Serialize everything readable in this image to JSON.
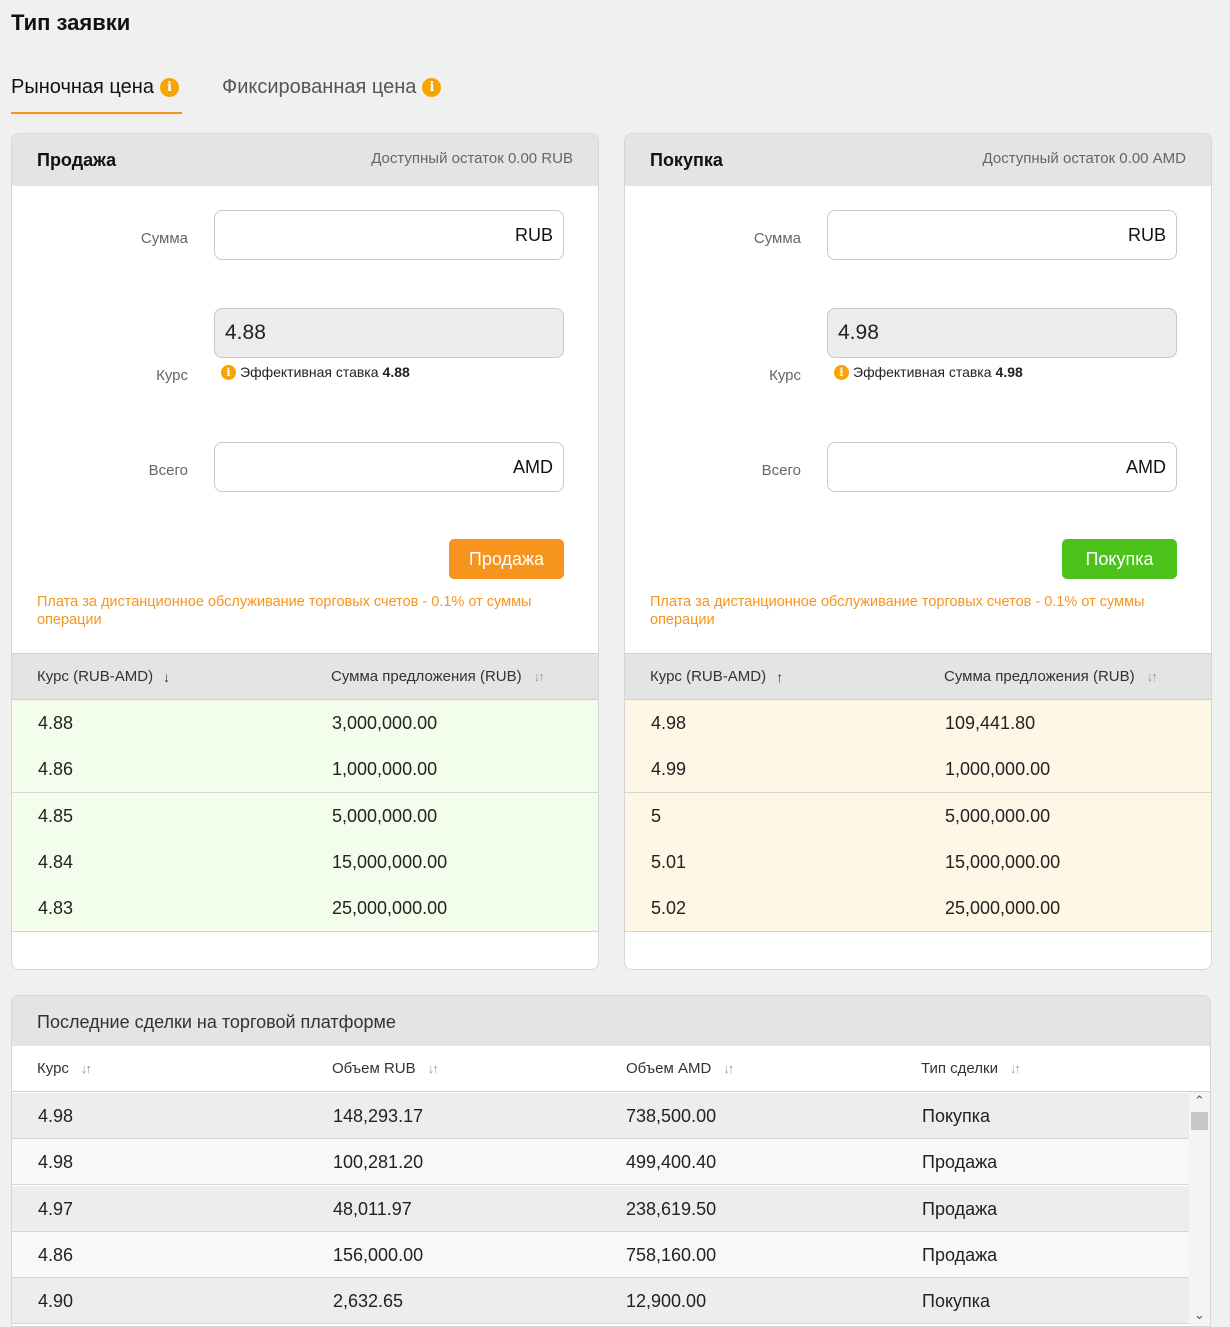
{
  "page": {
    "title": "Тип заявки"
  },
  "tabs": [
    {
      "label": "Рыночная цена",
      "active": true
    },
    {
      "label": "Фиксированная цена",
      "active": false
    }
  ],
  "sell_panel": {
    "title": "Продажа",
    "balance": "Доступный остаток 0.00 RUB",
    "amount_label": "Сумма",
    "amount_currency": "RUB",
    "amount_value": "",
    "rate_label": "Курс",
    "rate_value": "4.88",
    "effective_rate_label": "Эффективная ставка",
    "effective_rate_value": "4.88",
    "total_label": "Всего",
    "total_currency": "AMD",
    "total_value": "",
    "button_label": "Продажа",
    "fee_note": "Плата за дистанционное обслуживание торговых счетов - 0.1% от суммы операции",
    "orderbook_headers": {
      "rate": "Курс (RUB-AMD)",
      "amount": "Сумма предложения (RUB)"
    },
    "orderbook": [
      {
        "rate": "4.88",
        "amount": "3,000,000.00"
      },
      {
        "rate": "4.86",
        "amount": "1,000,000.00"
      },
      {
        "rate": "4.85",
        "amount": "5,000,000.00"
      },
      {
        "rate": "4.84",
        "amount": "15,000,000.00"
      },
      {
        "rate": "4.83",
        "amount": "25,000,000.00"
      }
    ]
  },
  "buy_panel": {
    "title": "Покупка",
    "balance": "Доступный остаток 0.00 AMD",
    "amount_label": "Сумма",
    "amount_currency": "RUB",
    "amount_value": "",
    "rate_label": "Курс",
    "rate_value": "4.98",
    "effective_rate_label": "Эффективная ставка",
    "effective_rate_value": "4.98",
    "total_label": "Всего",
    "total_currency": "AMD",
    "total_value": "",
    "button_label": "Покупка",
    "fee_note": "Плата за дистанционное обслуживание торговых счетов - 0.1% от суммы операции",
    "orderbook_headers": {
      "rate": "Курс (RUB-AMD)",
      "amount": "Сумма предложения (RUB)"
    },
    "orderbook": [
      {
        "rate": "4.98",
        "amount": "109,441.80"
      },
      {
        "rate": "4.99",
        "amount": "1,000,000.00"
      },
      {
        "rate": "5",
        "amount": "5,000,000.00"
      },
      {
        "rate": "5.01",
        "amount": "15,000,000.00"
      },
      {
        "rate": "5.02",
        "amount": "25,000,000.00"
      }
    ]
  },
  "trades": {
    "title": "Последние сделки на торговой платформе",
    "headers": {
      "rate": "Курс",
      "vol_rub": "Объем RUB",
      "vol_amd": "Объем AMD",
      "type": "Тип сделки"
    },
    "rows": [
      {
        "rate": "4.98",
        "vol_rub": "148,293.17",
        "vol_amd": "738,500.00",
        "type": "Покупка"
      },
      {
        "rate": "4.98",
        "vol_rub": "100,281.20",
        "vol_amd": "499,400.40",
        "type": "Продажа"
      },
      {
        "rate": "4.97",
        "vol_rub": "48,011.97",
        "vol_amd": "238,619.50",
        "type": "Продажа"
      },
      {
        "rate": "4.86",
        "vol_rub": "156,000.00",
        "vol_amd": "758,160.00",
        "type": "Продажа"
      },
      {
        "rate": "4.90",
        "vol_rub": "2,632.65",
        "vol_amd": "12,900.00",
        "type": "Покупка"
      }
    ]
  },
  "colors": {
    "accent_orange": "#f7941d",
    "buy_green": "#4cc21b",
    "sell_row_bg": "#f3fdec",
    "buy_row_bg": "#fff7e6",
    "info_icon": "#f7a400"
  },
  "icons": {
    "info": "i",
    "sort_desc": "↓",
    "sort_asc": "↑",
    "sort_both": "↓↑",
    "scroll_up": "⌃",
    "scroll_down": "⌄"
  }
}
